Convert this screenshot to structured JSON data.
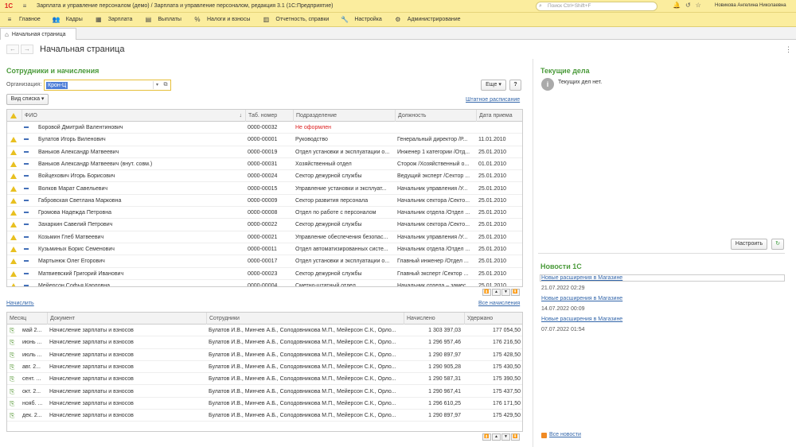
{
  "titlebar": {
    "title": "Зарплата и управление персоналом (демо) / Зарплата и управление персоналом, редакция 3.1  (1С:Предприятие)",
    "search_placeholder": "Поиск Ctrl+Shift+F",
    "user": "Новикова Ангелина Николаевна"
  },
  "menu": [
    {
      "label": "Главное",
      "icon": "menu-icon"
    },
    {
      "label": "Кадры",
      "icon": "people-icon"
    },
    {
      "label": "Зарплата",
      "icon": "calculator-icon"
    },
    {
      "label": "Выплаты",
      "icon": "wallet-icon"
    },
    {
      "label": "Налоги и взносы",
      "icon": "percent-icon"
    },
    {
      "label": "Отчетность, справки",
      "icon": "report-icon"
    },
    {
      "label": "Настройка",
      "icon": "wrench-icon"
    },
    {
      "label": "Администрирование",
      "icon": "gear-icon"
    }
  ],
  "tab": {
    "label": "Начальная страница"
  },
  "page": {
    "title": "Начальная страница"
  },
  "employees": {
    "section_title": "Сотрудники и начисления",
    "org_label": "Организация:",
    "org_value": "Крон-Ц",
    "more_button": "Еще",
    "help_button": "?",
    "view_button": "Вид списка",
    "staff_link": "Штатное расписание",
    "columns": [
      "ФИО",
      "Таб. номер",
      "Подразделение",
      "Должность",
      "Дата приема"
    ],
    "rows": [
      {
        "warn": false,
        "name": "Боровой Дмитрий Валентинович",
        "tab": "0000-00032",
        "dept": "Не оформлен",
        "pos": "",
        "date": "",
        "red": true
      },
      {
        "warn": true,
        "name": "Булатов Игорь Виленович",
        "tab": "0000-00001",
        "dept": "Руководство",
        "pos": "Генеральный директор /Р...",
        "date": "11.01.2010",
        "red": false
      },
      {
        "warn": true,
        "name": "Ваньков Александр Матвеевич",
        "tab": "0000-00019",
        "dept": "Отдел установки и эксплуатации о...",
        "pos": "Инженер 1 категории /Отд...",
        "date": "25.01.2010",
        "red": false
      },
      {
        "warn": true,
        "name": "Ваньков Александр Матвеевич (внут. совм.)",
        "tab": "0000-00031",
        "dept": "Хозяйственный отдел",
        "pos": "Сторож /Хозяйственный о...",
        "date": "01.01.2010",
        "red": false
      },
      {
        "warn": true,
        "name": "Войцехович Игорь Борисович",
        "tab": "0000-00024",
        "dept": "Сектор дежурной службы",
        "pos": "Ведущий эксперт /Сектор ...",
        "date": "25.01.2010",
        "red": false
      },
      {
        "warn": true,
        "name": "Волков Марат Савельевич",
        "tab": "0000-00015",
        "dept": "Управление установки и эксплуат...",
        "pos": "Начальник управления /У...",
        "date": "25.01.2010",
        "red": false
      },
      {
        "warn": true,
        "name": "Габровская Светлана Марковна",
        "tab": "0000-00009",
        "dept": "Сектор развития персонала",
        "pos": "Начальник сектора /Секто...",
        "date": "25.01.2010",
        "red": false
      },
      {
        "warn": true,
        "name": "Громова Надежда Петровна",
        "tab": "0000-00008",
        "dept": "Отдел по работе с персоналом",
        "pos": "Начальник отдела /Отдел ...",
        "date": "25.01.2010",
        "red": false
      },
      {
        "warn": true,
        "name": "Захаркин Савелий Петрович",
        "tab": "0000-00022",
        "dept": "Сектор дежурной службы",
        "pos": "Начальник сектора /Секто...",
        "date": "25.01.2010",
        "red": false
      },
      {
        "warn": true,
        "name": "Козьмин Глеб Матвеевич",
        "tab": "0000-00021",
        "dept": "Управление обеспечения безопас...",
        "pos": "Начальник управления /У...",
        "date": "25.01.2010",
        "red": false
      },
      {
        "warn": true,
        "name": "Кузьминых Борис Семенович",
        "tab": "0000-00011",
        "dept": "Отдел автоматизированных систе...",
        "pos": "Начальник отдела /Отдел ...",
        "date": "25.01.2010",
        "red": false
      },
      {
        "warn": true,
        "name": "Мартынюк Олег Егорович",
        "tab": "0000-00017",
        "dept": "Отдел установки и эксплуатации о...",
        "pos": "Главный инженер /Отдел ...",
        "date": "25.01.2010",
        "red": false
      },
      {
        "warn": true,
        "name": "Матвиевский Григорий Иванович",
        "tab": "0000-00023",
        "dept": "Сектор дежурной службы",
        "pos": "Главный эксперт /Сектор ...",
        "date": "25.01.2010",
        "red": false
      },
      {
        "warn": true,
        "name": "Мейерсон Софья Карловна",
        "tab": "0000-00004",
        "dept": "Сметно-штатный отдел",
        "pos": "Начальник отдела – замес...",
        "date": "25.01.2010",
        "red": false
      }
    ]
  },
  "accruals": {
    "accrue_link": "Начислить",
    "all_link": "Все начисления",
    "columns": [
      "Месяц",
      "Документ",
      "Сотрудники",
      "Начислено",
      "Удержано"
    ],
    "rows": [
      {
        "month": "май 2...",
        "doc": "Начисление зарплаты и взносов",
        "staff": "Булатов И.В., Минчев А.Б., Солодовникова М.П., Мейерсон С.К., Орло...",
        "accrued": "1 303 397,03",
        "withheld": "177 054,50"
      },
      {
        "month": "июнь ...",
        "doc": "Начисление зарплаты и взносов",
        "staff": "Булатов И.В., Минчев А.Б., Солодовникова М.П., Мейерсон С.К., Орло...",
        "accrued": "1 296 957,46",
        "withheld": "176 216,50"
      },
      {
        "month": "июль ...",
        "doc": "Начисление зарплаты и взносов",
        "staff": "Булатов И.В., Минчев А.Б., Солодовникова М.П., Мейерсон С.К., Орло...",
        "accrued": "1 290 897,97",
        "withheld": "175 428,50"
      },
      {
        "month": "авг. 2...",
        "doc": "Начисление зарплаты и взносов",
        "staff": "Булатов И.В., Минчев А.Б., Солодовникова М.П., Мейерсон С.К., Орло...",
        "accrued": "1 290 905,28",
        "withheld": "175 430,50"
      },
      {
        "month": "сент. ...",
        "doc": "Начисление зарплаты и взносов",
        "staff": "Булатов И.В., Минчев А.Б., Солодовникова М.П., Мейерсон С.К., Орло...",
        "accrued": "1 290 587,31",
        "withheld": "175 390,50"
      },
      {
        "month": "окт. 2...",
        "doc": "Начисление зарплаты и взносов",
        "staff": "Булатов И.В., Минчев А.Б., Солодовникова М.П., Мейерсон С.К., Орло...",
        "accrued": "1 290 967,41",
        "withheld": "175 437,50"
      },
      {
        "month": "нояб. ...",
        "doc": "Начисление зарплаты и взносов",
        "staff": "Булатов И.В., Минчев А.Б., Солодовникова М.П., Мейерсон С.К., Орло...",
        "accrued": "1 296 610,25",
        "withheld": "176 171,50"
      },
      {
        "month": "дек. 2...",
        "doc": "Начисление зарплаты и взносов",
        "staff": "Булатов И.В., Минчев А.Б., Солодовникова М.П., Мейерсон С.К., Орло...",
        "accrued": "1 290 897,97",
        "withheld": "175 429,50"
      }
    ]
  },
  "tasks": {
    "title": "Текущие дела",
    "empty_text": "Текущих дел нет.",
    "setup_button": "Настроить"
  },
  "news": {
    "title": "Новости 1С",
    "items": [
      {
        "title": "Новые расширения в Магазине",
        "date": "21.07.2022 02:29"
      },
      {
        "title": "Новые расширения в Магазине",
        "date": "14.07.2022 00:09"
      },
      {
        "title": "Новые расширения в Магазине",
        "date": "07.07.2022 01:54"
      }
    ],
    "all_link": "Все новости"
  }
}
